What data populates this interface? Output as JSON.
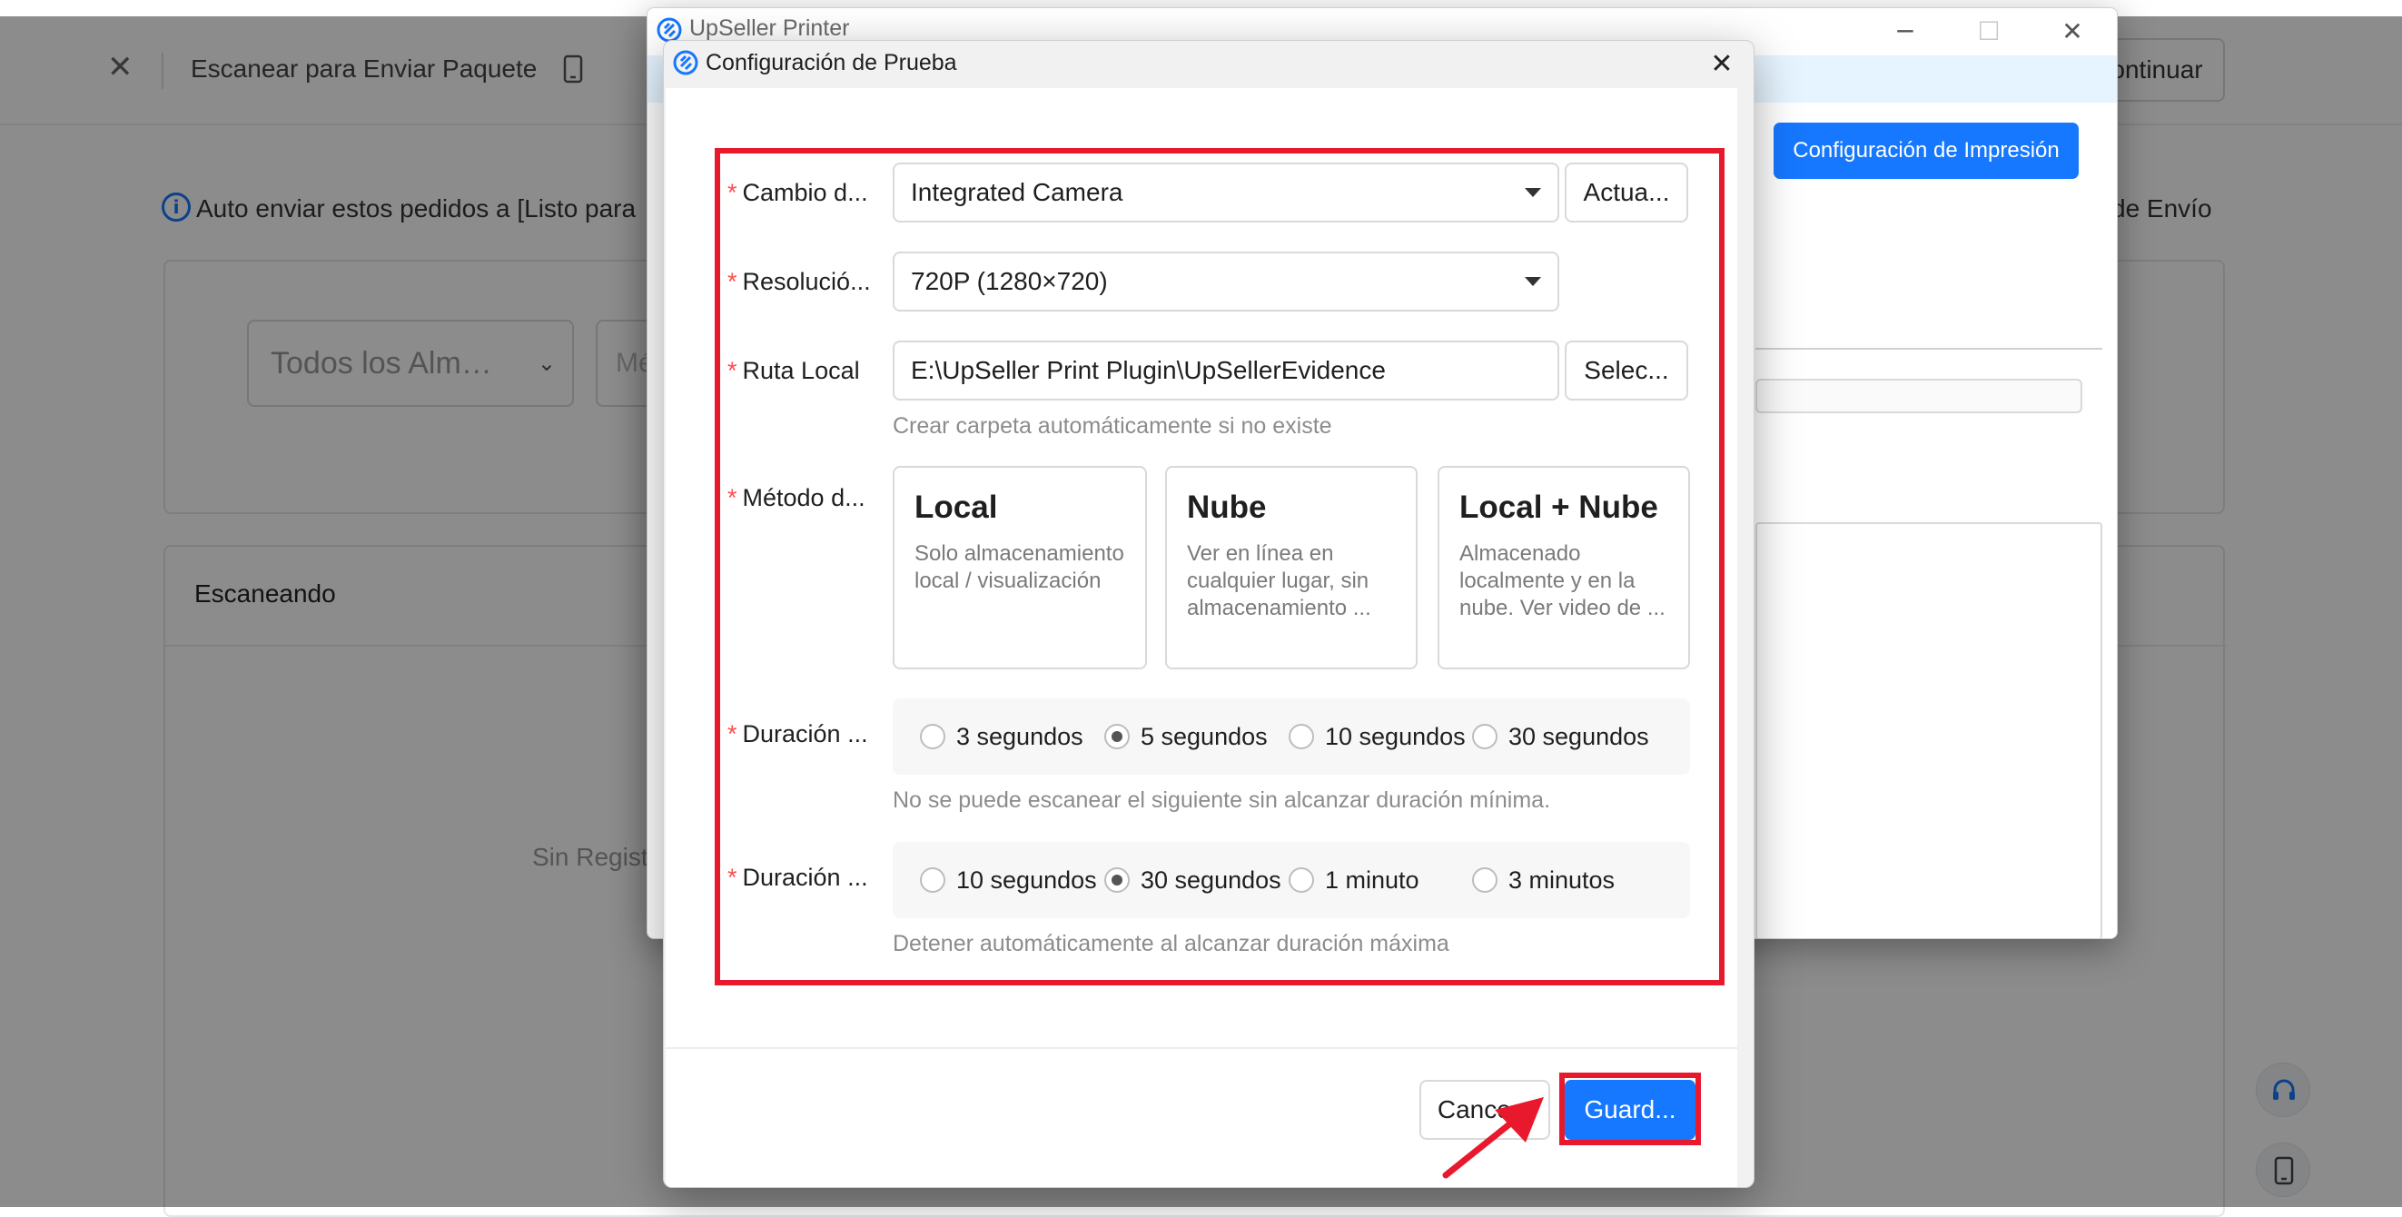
{
  "background_page": {
    "header_title": "Escanear para Enviar Paquete",
    "continue_label": "ontinuar",
    "info_text": "Auto enviar estos pedidos a [Listo para",
    "info_suffix": "de Envío",
    "warehouse_select": "Todos los Alm…",
    "search_placeholder": "Mé",
    "scanning_title": "Escaneando",
    "no_records": "Sin Regist"
  },
  "printer_window": {
    "title": "UpSeller Printer",
    "print_settings_button": "Configuración de Impresión"
  },
  "dialog": {
    "title": "Configuración de Prueba",
    "fields": {
      "camera": {
        "label": "Cambio d...",
        "value": "Integrated Camera",
        "action": "Actua..."
      },
      "resolution": {
        "label": "Resolució...",
        "value": "720P (1280×720)"
      },
      "local_path": {
        "label": "Ruta Local",
        "value": "E:\\UpSeller Print Plugin\\UpSellerEvidence",
        "action": "Selec...",
        "hint": "Crear carpeta automáticamente si no existe"
      },
      "method": {
        "label": "Método d...",
        "options": [
          {
            "title": "Local",
            "desc": "Solo almacenamiento local / visualización"
          },
          {
            "title": "Nube",
            "desc": "Ver en línea en cualquier lugar, sin almacenamiento ..."
          },
          {
            "title": "Local + Nube",
            "desc": "Almacenado localmente y en la nube. Ver video de ..."
          }
        ]
      },
      "min_duration": {
        "label": "Duración ...",
        "options": [
          "3 segundos",
          "5 segundos",
          "10 segundos",
          "30 segundos"
        ],
        "selected": "5 segundos",
        "hint": "No se puede escanear el siguiente sin alcanzar duración mínima."
      },
      "max_duration": {
        "label": "Duración ...",
        "options": [
          "10 segundos",
          "30 segundos",
          "1 minuto",
          "3 minutos"
        ],
        "selected": "30 segundos",
        "hint": "Detener automáticamente al alcanzar duración máxima"
      }
    },
    "footer": {
      "cancel": "Cance...",
      "save": "Guard..."
    }
  },
  "colors": {
    "primary": "#1677ff",
    "highlight": "#e8192c",
    "required": "#ff4d4f"
  },
  "icons": {
    "close": "close-icon",
    "app_logo": "upseller-logo-icon",
    "support": "headset-icon",
    "mobile": "mobile-icon"
  }
}
